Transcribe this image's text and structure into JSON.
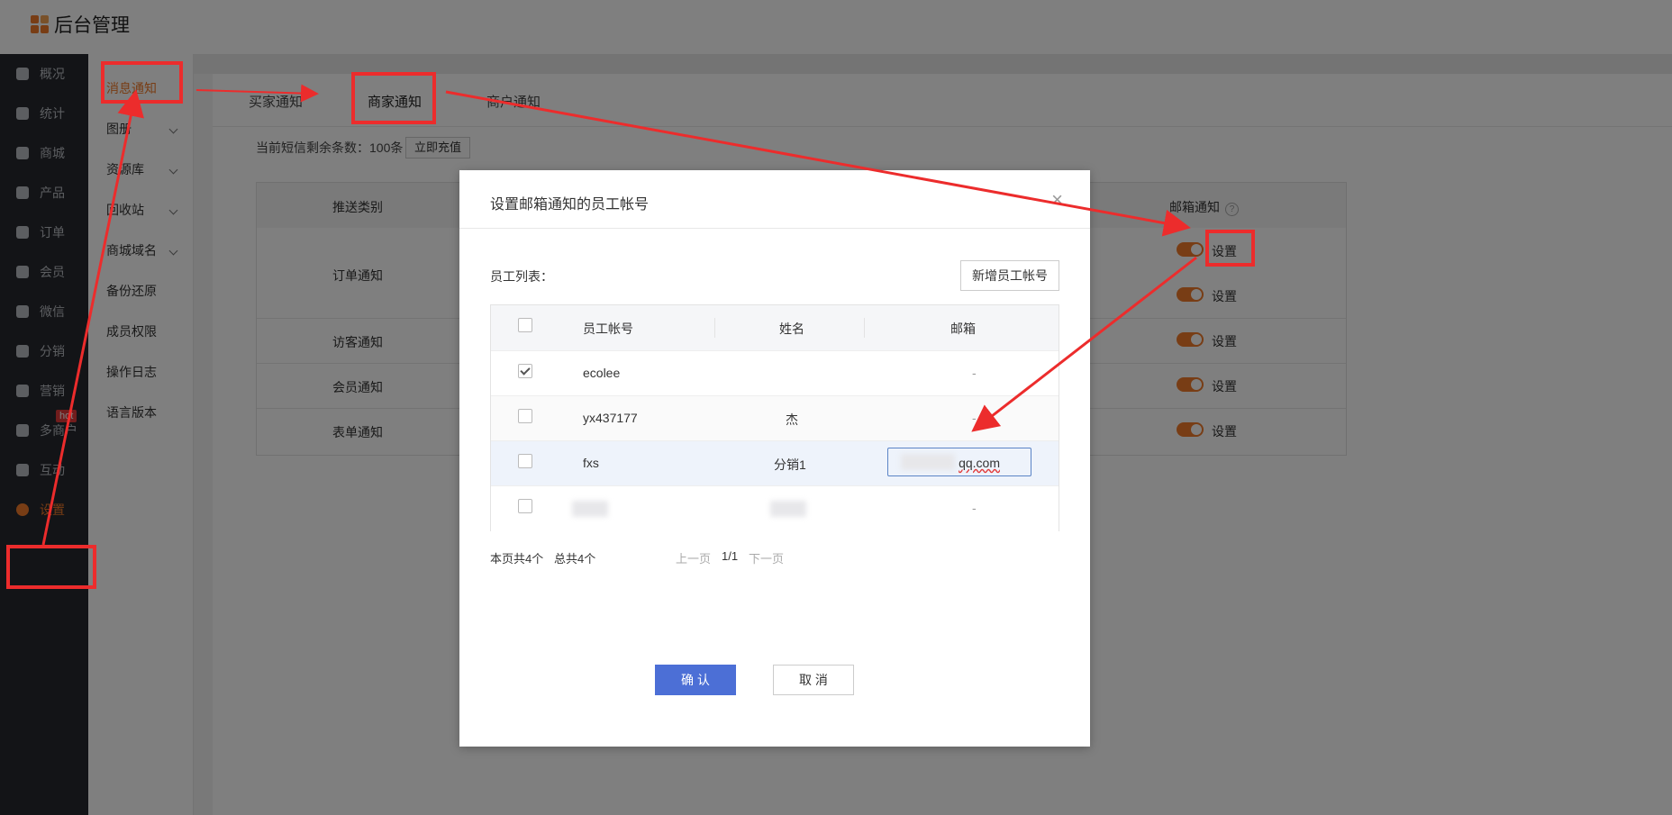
{
  "header": {
    "title": "后台管理"
  },
  "nav": {
    "items": [
      {
        "label": "概况",
        "icon": "layers-icon"
      },
      {
        "label": "统计",
        "icon": "chart-icon"
      },
      {
        "label": "商城",
        "icon": "mail-icon"
      },
      {
        "label": "产品",
        "icon": "grid-icon"
      },
      {
        "label": "订单",
        "icon": "order-icon"
      },
      {
        "label": "会员",
        "icon": "crown-icon"
      },
      {
        "label": "微信",
        "icon": "wechat-icon"
      },
      {
        "label": "分销",
        "icon": "users-icon"
      },
      {
        "label": "营销",
        "icon": "flag-icon"
      },
      {
        "label": "多商户",
        "icon": "store-icon"
      },
      {
        "label": "互动",
        "icon": "interact-icon"
      },
      {
        "label": "设置",
        "icon": "gear-icon"
      }
    ],
    "hot_badge": "hot"
  },
  "subnav": {
    "items": [
      "消息通知",
      "图册",
      "资源库",
      "回收站",
      "商城域名",
      "备份还原",
      "成员权限",
      "操作日志",
      "语言版本"
    ]
  },
  "tabs": [
    "买家通知",
    "商家通知",
    "商户通知"
  ],
  "sms": {
    "text": "当前短信剩余条数：100条",
    "recharge_label": "立即充值"
  },
  "notify_table": {
    "headers": {
      "type": "推送类别",
      "email": "邮箱通知"
    },
    "rows": [
      "订单通知",
      "访客通知",
      "会员通知",
      "表单通知"
    ],
    "set_label": "设置"
  },
  "modal": {
    "title": "设置邮箱通知的员工帐号",
    "list_label": "员工列表：",
    "add_button": "新增员工帐号",
    "columns": [
      "员工帐号",
      "姓名",
      "邮箱"
    ],
    "rows": [
      {
        "account": "ecolee",
        "name": "",
        "email": "-",
        "checked": true
      },
      {
        "account": "yx437177",
        "name": "杰",
        "email": "-",
        "checked": false
      },
      {
        "account": "fxs",
        "name": "分销1",
        "email": "qq.com",
        "checked": false
      },
      {
        "account": "",
        "name": "",
        "email": "-",
        "checked": false
      }
    ],
    "page_count": "本页共4个",
    "total_count": "总共4个",
    "prev": "上一页",
    "page": "1/1",
    "next": "下一页",
    "confirm": "确 认",
    "cancel": "取 消"
  },
  "colors": {
    "accent": "#f07a2a",
    "primary": "#4c6fd6",
    "annotation": "#ec2c2c"
  }
}
